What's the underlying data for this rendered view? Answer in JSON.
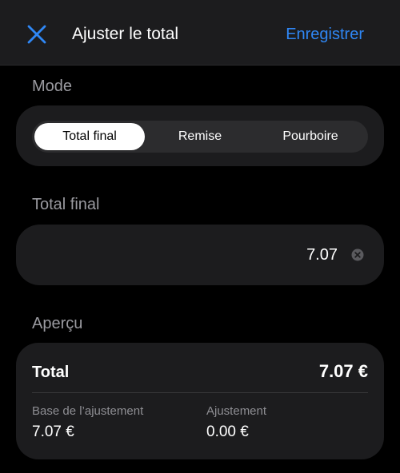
{
  "header": {
    "title": "Ajuster le total",
    "save_label": "Enregistrer",
    "close_icon": "close-icon"
  },
  "mode": {
    "label": "Mode",
    "options": [
      "Total final",
      "Remise",
      "Pourboire"
    ],
    "selected": "Total final"
  },
  "total_field": {
    "label": "Total final",
    "value": "7.07",
    "clear_icon": "clear-icon"
  },
  "preview": {
    "label": "Aperçu",
    "total_label": "Total",
    "total_value": "7.07 €",
    "base_label": "Base de l’ajustement",
    "base_value": "7.07 €",
    "adjustment_label": "Ajustement",
    "adjustment_value": "0.00 €"
  },
  "colors": {
    "accent": "#2f87f5",
    "background": "#000000",
    "card": "#1c1c1e"
  }
}
